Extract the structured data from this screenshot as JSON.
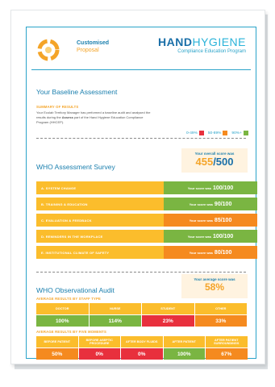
{
  "header": {
    "title": "Customised",
    "subtitle": "Proposal",
    "brand_hand": "HAND",
    "brand_hygiene": "HYGIENE",
    "brand_sub": "Compliance Education Program"
  },
  "baseline": {
    "title": "Your Baseline Assessment",
    "summary_heading": "SUMMARY OF RESULTS",
    "description_before": "Your Ecolab Territory Manager has performed a baseline audit and analysed the results during the ",
    "description_bold": "Assess",
    "description_after": " part of the Hand Hygiene Education Compliance Program (HHCEP).",
    "legend": [
      {
        "label": "0-49%",
        "color": "#e8303d"
      },
      {
        "label": "50-89%",
        "color": "#f58a1f"
      },
      {
        "label": "90%+",
        "color": "#7ab542"
      }
    ]
  },
  "survey": {
    "title": "WHO Assessment Survey",
    "overall_label": "Your overall score was",
    "overall_score": "455",
    "overall_total": "/500",
    "score_prefix": "Your score was",
    "rows": [
      {
        "label": "A. SYSTEM CHANGE",
        "score": "100/100",
        "color": "#7ab542"
      },
      {
        "label": "B. TRAINING & EDUCATION",
        "score": "90/100",
        "color": "#7ab542"
      },
      {
        "label": "C. EVALUATION & FEEDBACK",
        "score": "85/100",
        "color": "#f58a1f"
      },
      {
        "label": "D. REMINDERS IN THE WORKPLACE",
        "score": "100/100",
        "color": "#7ab542"
      },
      {
        "label": "E. INSTITUTIONAL CLIMATE OF SAFETY",
        "score": "80/100",
        "color": "#f58a1f"
      }
    ]
  },
  "audit": {
    "title": "WHO Observational Audit",
    "average_label": "Your average score was",
    "average_score": "58%",
    "staff_heading": "AVERAGE RESULTS BY STAFF TYPE",
    "staff": [
      {
        "label": "DOCTOR",
        "value": "100%",
        "color": "#7ab542"
      },
      {
        "label": "NURSE",
        "value": "114%",
        "color": "#7ab542"
      },
      {
        "label": "STUDENT",
        "value": "23%",
        "color": "#e8303d"
      },
      {
        "label": "OTHER",
        "value": "33%",
        "color": "#f58a1f"
      }
    ],
    "moments_heading": "AVERAGE RESULTS BY FIVE MOMENTS",
    "moments": [
      {
        "label": "BEFORE PATIENT",
        "value": "50%",
        "color": "#f58a1f"
      },
      {
        "label": "BEFORE ASEPTIC PROCEDURE",
        "value": "0%",
        "color": "#e8303d"
      },
      {
        "label": "AFTER BODY FLUIDS",
        "value": "0%",
        "color": "#e8303d"
      },
      {
        "label": "AFTER PATIENT",
        "value": "100%",
        "color": "#7ab542"
      },
      {
        "label": "AFTER PATIENT SURROUNDINGS",
        "value": "67%",
        "color": "#f58a1f"
      }
    ]
  }
}
